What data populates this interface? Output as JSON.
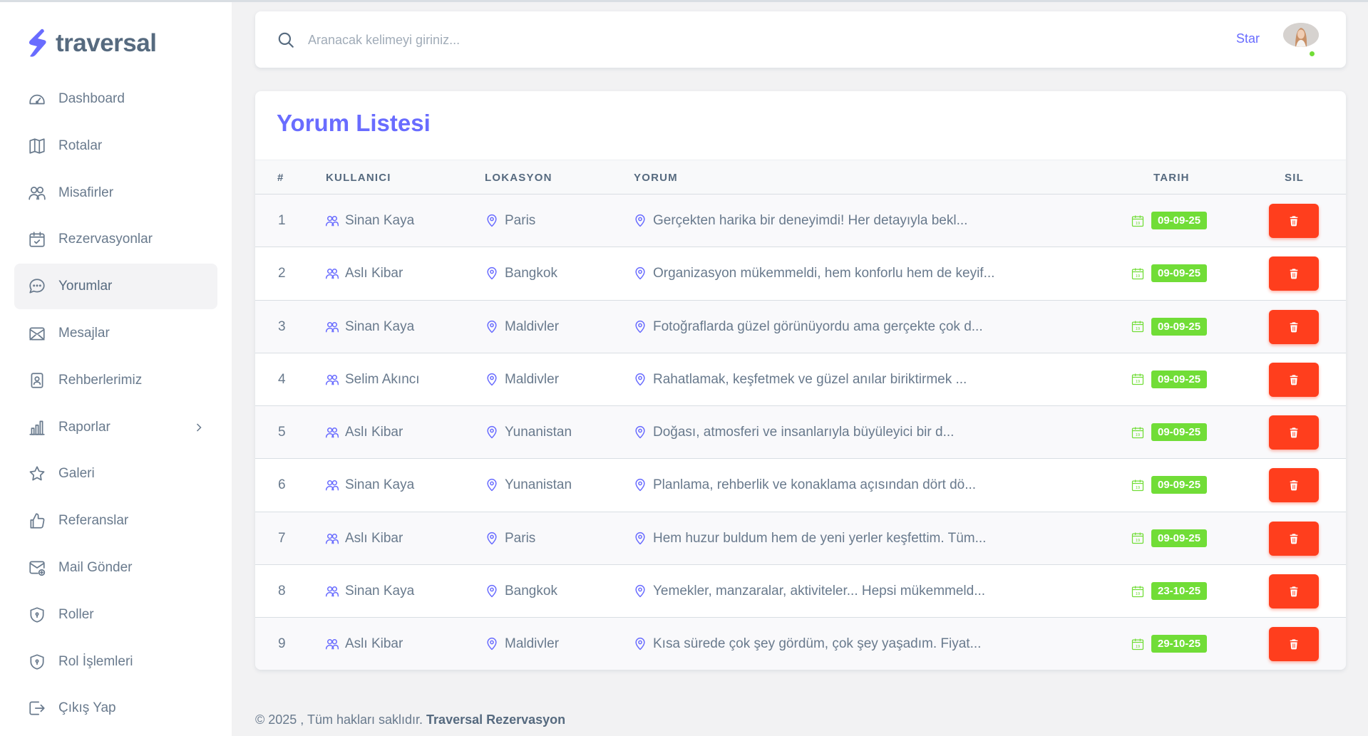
{
  "brand": {
    "name": "traversal"
  },
  "sidebar": {
    "items": [
      {
        "label": "Dashboard",
        "icon": "dashboard-icon"
      },
      {
        "label": "Rotalar",
        "icon": "map-icon"
      },
      {
        "label": "Misafirler",
        "icon": "users-icon"
      },
      {
        "label": "Rezervasyonlar",
        "icon": "calendar-check-icon"
      },
      {
        "label": "Yorumlar",
        "icon": "chat-icon",
        "active": true
      },
      {
        "label": "Mesajlar",
        "icon": "envelope-icon"
      },
      {
        "label": "Rehberlerimiz",
        "icon": "id-badge-icon"
      },
      {
        "label": "Raporlar",
        "icon": "bar-chart-icon",
        "has_submenu": true
      },
      {
        "label": "Galeri",
        "icon": "star-icon"
      },
      {
        "label": "Referanslar",
        "icon": "thumb-up-icon"
      },
      {
        "label": "Mail Gönder",
        "icon": "mail-send-icon"
      },
      {
        "label": "Roller",
        "icon": "shield-icon"
      },
      {
        "label": "Rol İşlemleri",
        "icon": "shield-icon"
      },
      {
        "label": "Çıkış Yap",
        "icon": "logout-icon"
      }
    ]
  },
  "navbar": {
    "search_placeholder": "Aranacak kelimeyi giriniz...",
    "star_label": "Star",
    "status_color": "#71dd37"
  },
  "card": {
    "title": "Yorum Listesi",
    "columns": [
      "#",
      "KULLANICI",
      "LOKASYON",
      "YORUM",
      "TARIH",
      "SIL"
    ],
    "rows": [
      {
        "no": "1",
        "user": "Sinan Kaya",
        "location": "Paris",
        "comment": "Gerçekten harika bir deneyimdi! Her detayıyla bekl...",
        "date": "09-09-25"
      },
      {
        "no": "2",
        "user": "Aslı Kibar",
        "location": "Bangkok",
        "comment": "Organizasyon mükemmeldi, hem konforlu hem de keyif...",
        "date": "09-09-25"
      },
      {
        "no": "3",
        "user": "Sinan Kaya",
        "location": "Maldivler",
        "comment": "Fotoğraflarda güzel görünüyordu ama gerçekte çok d...",
        "date": "09-09-25"
      },
      {
        "no": "4",
        "user": "Selim Akıncı",
        "location": "Maldivler",
        "comment": "Rahatlamak, keşfetmek ve güzel anılar biriktirmek ...",
        "date": "09-09-25"
      },
      {
        "no": "5",
        "user": "Aslı Kibar",
        "location": "Yunanistan",
        "comment": "Doğası, atmosferi ve insanlarıyla büyüleyici bir d...",
        "date": "09-09-25"
      },
      {
        "no": "6",
        "user": "Sinan Kaya",
        "location": "Yunanistan",
        "comment": "Planlama, rehberlik ve konaklama açısından dört dö...",
        "date": "09-09-25"
      },
      {
        "no": "7",
        "user": "Aslı Kibar",
        "location": "Paris",
        "comment": "Hem huzur buldum hem de yeni yerler keşfettim. Tüm...",
        "date": "09-09-25"
      },
      {
        "no": "8",
        "user": "Sinan Kaya",
        "location": "Bangkok",
        "comment": "Yemekler, manzaralar, aktiviteler... Hepsi mükemmeld...",
        "date": "23-10-25"
      },
      {
        "no": "9",
        "user": "Aslı Kibar",
        "location": "Maldivler",
        "comment": "Kısa sürede çok şey gördüm, çok şey yaşadım. Fiyat...",
        "date": "29-10-25"
      }
    ]
  },
  "footer": {
    "prefix": "© 2025 , Tüm hakları saklıdır. ",
    "company": "Traversal Rezervasyon"
  },
  "colors": {
    "accent": "#696cff",
    "badge": "#71dd37",
    "danger": "#ff3e1d"
  }
}
